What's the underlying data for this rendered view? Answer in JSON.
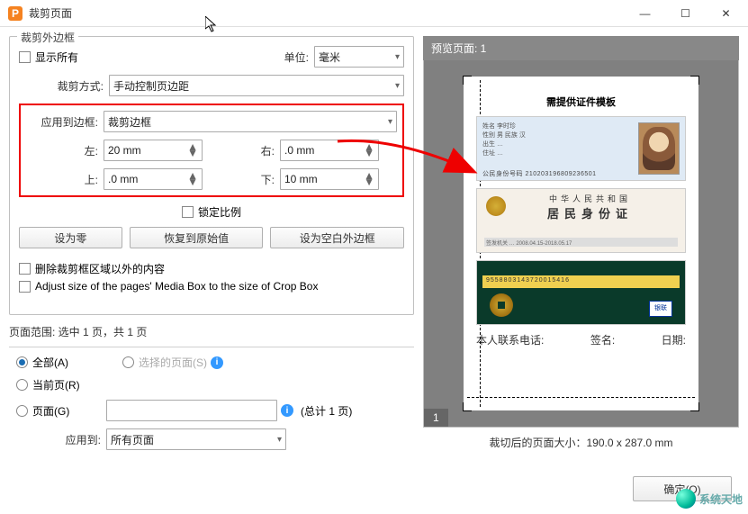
{
  "window": {
    "title": "裁剪页面"
  },
  "win_controls": {
    "min": "—",
    "max": "☐",
    "close": "✕"
  },
  "group_margin": {
    "legend": "裁剪外边框",
    "show_all": "显示所有",
    "unit_label": "单位:",
    "unit_value": "毫米",
    "crop_method_label": "裁剪方式:",
    "crop_method_value": "手动控制页边距",
    "apply_to_box_label": "应用到边框:",
    "apply_to_box_value": "裁剪边框",
    "left_label": "左:",
    "left_value": "20 mm",
    "right_label": "右:",
    "right_value": ".0 mm",
    "top_label": "上:",
    "top_value": ".0 mm",
    "bottom_label": "下:",
    "bottom_value": "10 mm",
    "lock_ratio": "锁定比例",
    "btn_zero": "设为零",
    "btn_restore": "恢复到原始值",
    "btn_blank": "设为空白外边框",
    "cb_delete_outside": "删除裁剪框区域以外的内容",
    "cb_adjust_media": "Adjust size of the pages' Media Box to the size of Crop Box"
  },
  "page_range": {
    "heading": "页面范围: 选中 1 页，共 1 页",
    "all": "全部(A)",
    "selected": "选择的页面(S)",
    "current": "当前页(R)",
    "pages": "页面(G)",
    "pages_value": "",
    "total": "(总计 1 页)",
    "apply_to_label": "应用到:",
    "apply_to_value": "所有页面"
  },
  "preview": {
    "header": "预览页面: 1",
    "page_num": "1",
    "doc_title": "需提供证件模板",
    "card1_lines": "姓名 李时珍\n性别 男  民族 汉\n出生 …\n住址 …",
    "card1_num": "公民身份号码 210203196809236501",
    "card2_t1": "中华人民共和国",
    "card2_t2": "居民身份证",
    "card2_bar": "签发机关 …   2008.04.15-2018.05.17",
    "card3_num": "9558803143720015416",
    "footer_1": "本人联系电话:",
    "footer_2": "签名:",
    "footer_3": "日期:"
  },
  "cropped_size": "裁切后的页面大小：190.0 x 287.0 mm",
  "ok": "确定(O)",
  "watermark": "系统天地"
}
